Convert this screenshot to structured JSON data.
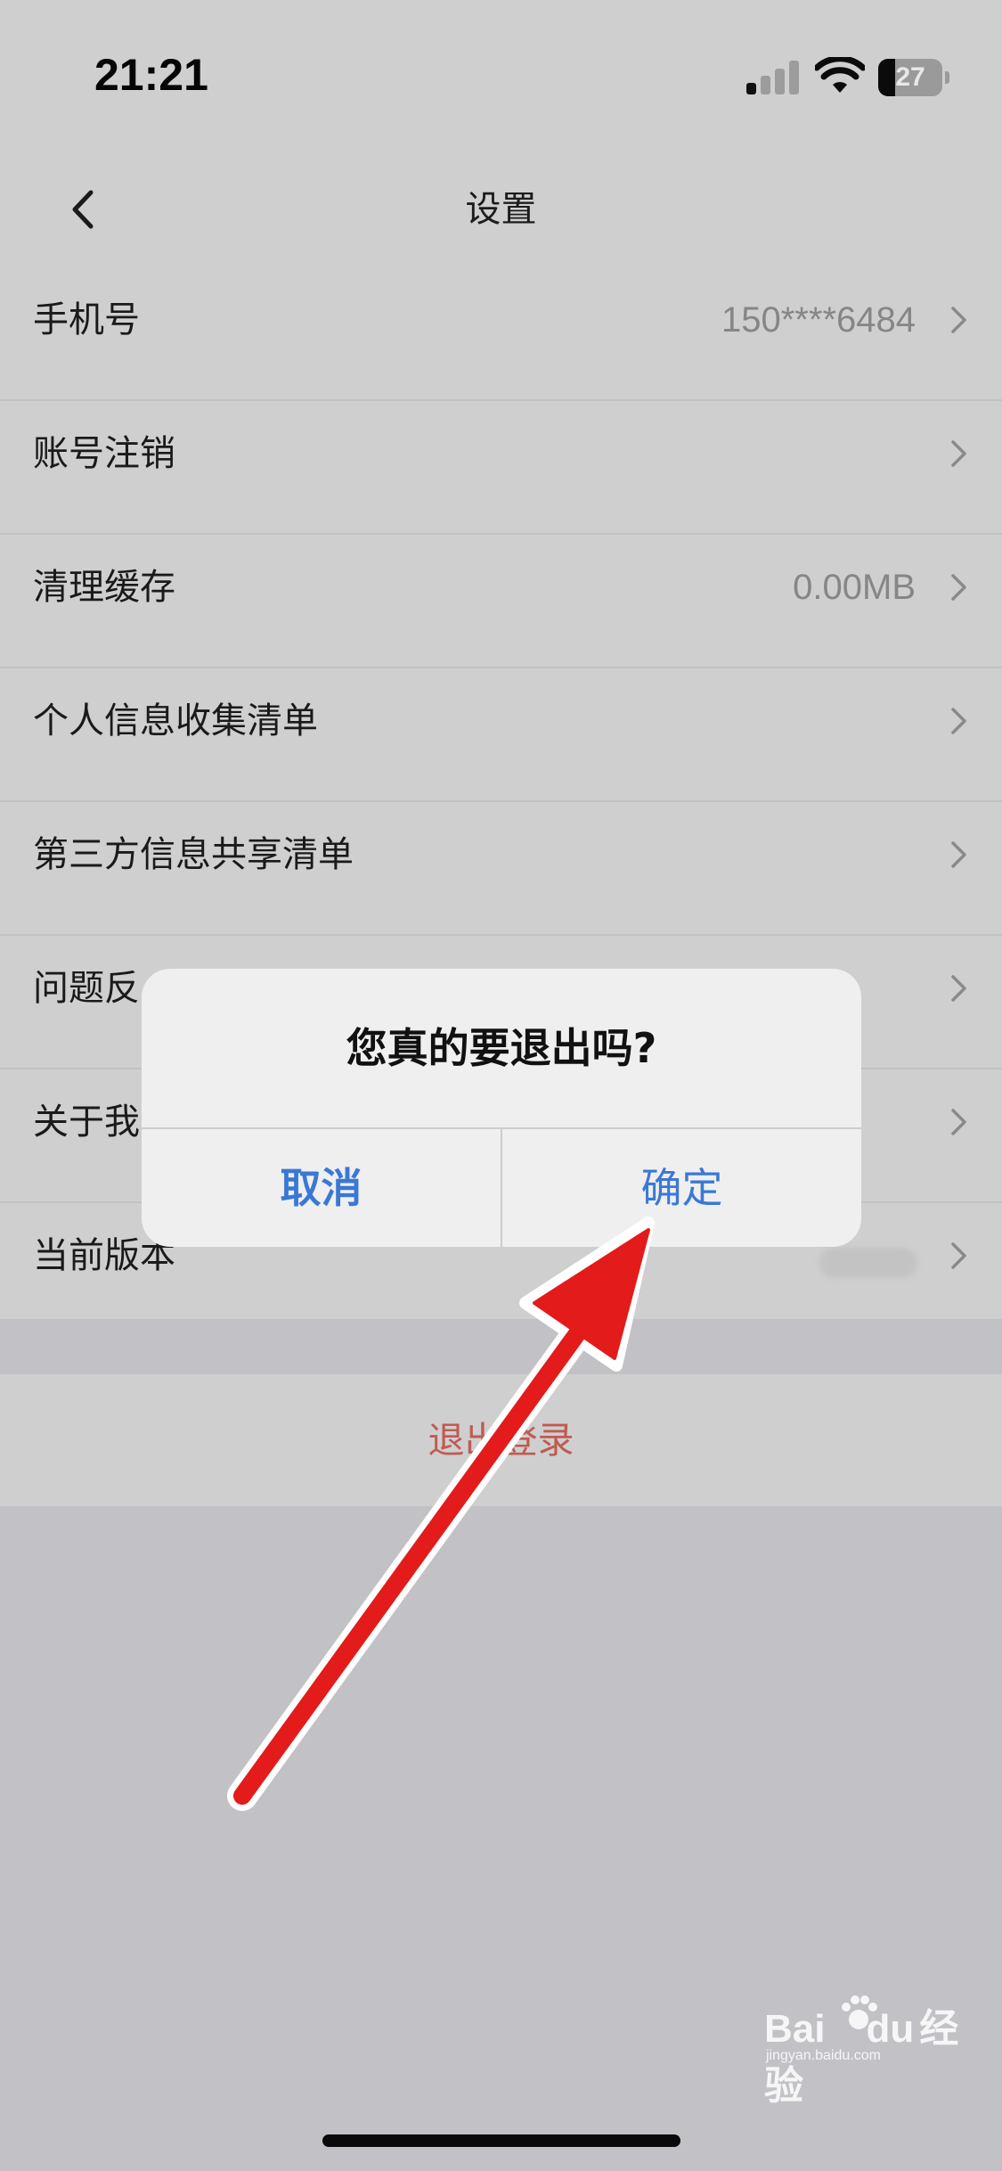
{
  "status_bar": {
    "time": "21:21",
    "battery": "27",
    "battery_level_pct": 27
  },
  "nav": {
    "title": "设置"
  },
  "settings": {
    "rows": [
      {
        "label": "手机号",
        "value": "150****6484"
      },
      {
        "label": "账号注销",
        "value": ""
      },
      {
        "label": "清理缓存",
        "value": "0.00MB"
      },
      {
        "label": "个人信息收集清单",
        "value": ""
      },
      {
        "label": "第三方信息共享清单",
        "value": ""
      },
      {
        "label": "问题反",
        "value": ""
      },
      {
        "label": "关于我",
        "value": ""
      },
      {
        "label": "当前版本",
        "value": ""
      }
    ],
    "logout": "退出登录"
  },
  "dialog": {
    "title": "您真的要退出吗?",
    "cancel": "取消",
    "confirm": "确定"
  },
  "watermark": {
    "brand": "Bai",
    "brand2": "du",
    "cn": "经验",
    "url": "jingyan.baidu.com"
  },
  "colors": {
    "accent": "#3a78d6",
    "logout": "#bf5b52",
    "arrow": "#e31b1b"
  }
}
